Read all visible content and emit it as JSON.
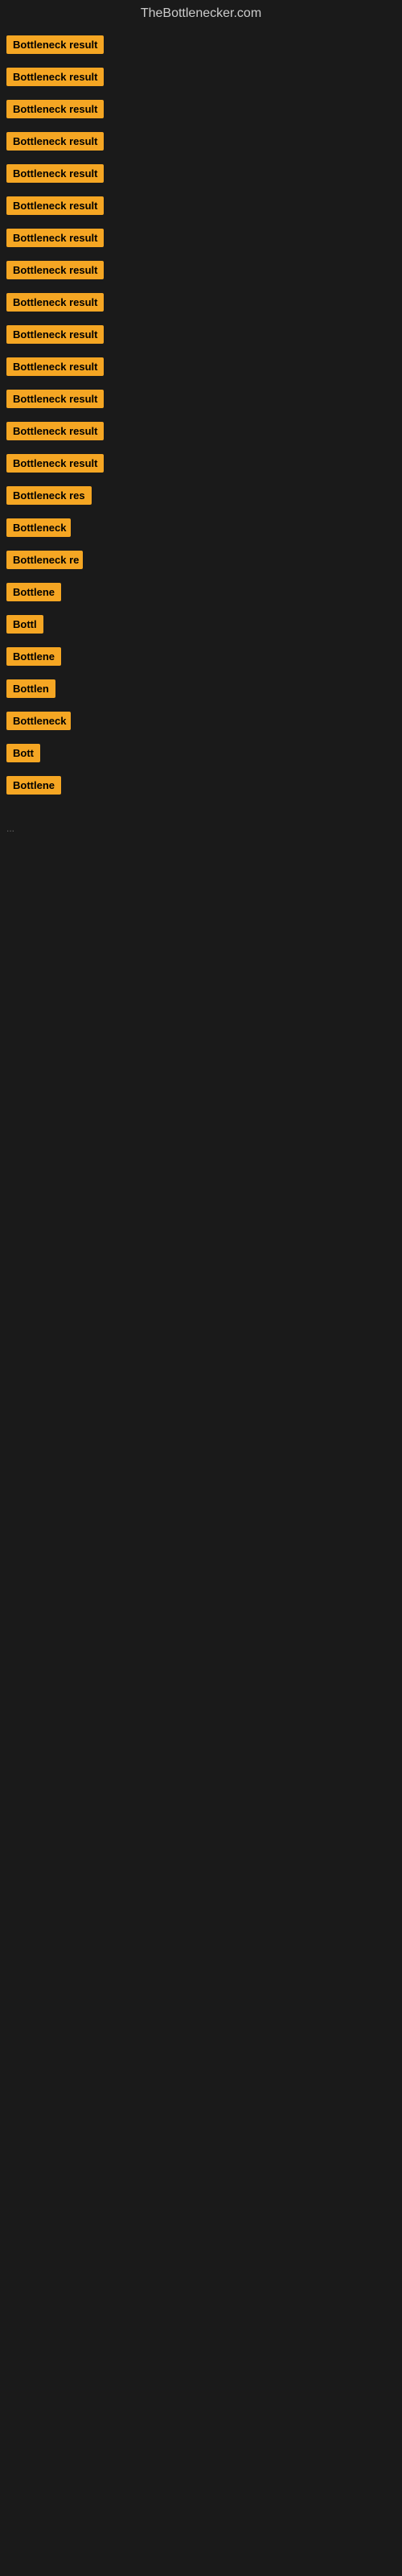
{
  "header": {
    "title": "TheBottlenecker.com"
  },
  "items": [
    {
      "label": "Bottleneck result",
      "width": 130
    },
    {
      "label": "Bottleneck result",
      "width": 130
    },
    {
      "label": "Bottleneck result",
      "width": 130
    },
    {
      "label": "Bottleneck result",
      "width": 130
    },
    {
      "label": "Bottleneck result",
      "width": 130
    },
    {
      "label": "Bottleneck result",
      "width": 130
    },
    {
      "label": "Bottleneck result",
      "width": 130
    },
    {
      "label": "Bottleneck result",
      "width": 130
    },
    {
      "label": "Bottleneck result",
      "width": 130
    },
    {
      "label": "Bottleneck result",
      "width": 130
    },
    {
      "label": "Bottleneck result",
      "width": 130
    },
    {
      "label": "Bottleneck result",
      "width": 130
    },
    {
      "label": "Bottleneck result",
      "width": 130
    },
    {
      "label": "Bottleneck result",
      "width": 130
    },
    {
      "label": "Bottleneck res",
      "width": 110
    },
    {
      "label": "Bottleneck",
      "width": 80
    },
    {
      "label": "Bottleneck re",
      "width": 95
    },
    {
      "label": "Bottlene",
      "width": 70
    },
    {
      "label": "Bottl",
      "width": 50
    },
    {
      "label": "Bottlene",
      "width": 70
    },
    {
      "label": "Bottlen",
      "width": 65
    },
    {
      "label": "Bottleneck",
      "width": 80
    },
    {
      "label": "Bott",
      "width": 45
    },
    {
      "label": "Bottlene",
      "width": 70
    }
  ],
  "ellipsis": "..."
}
